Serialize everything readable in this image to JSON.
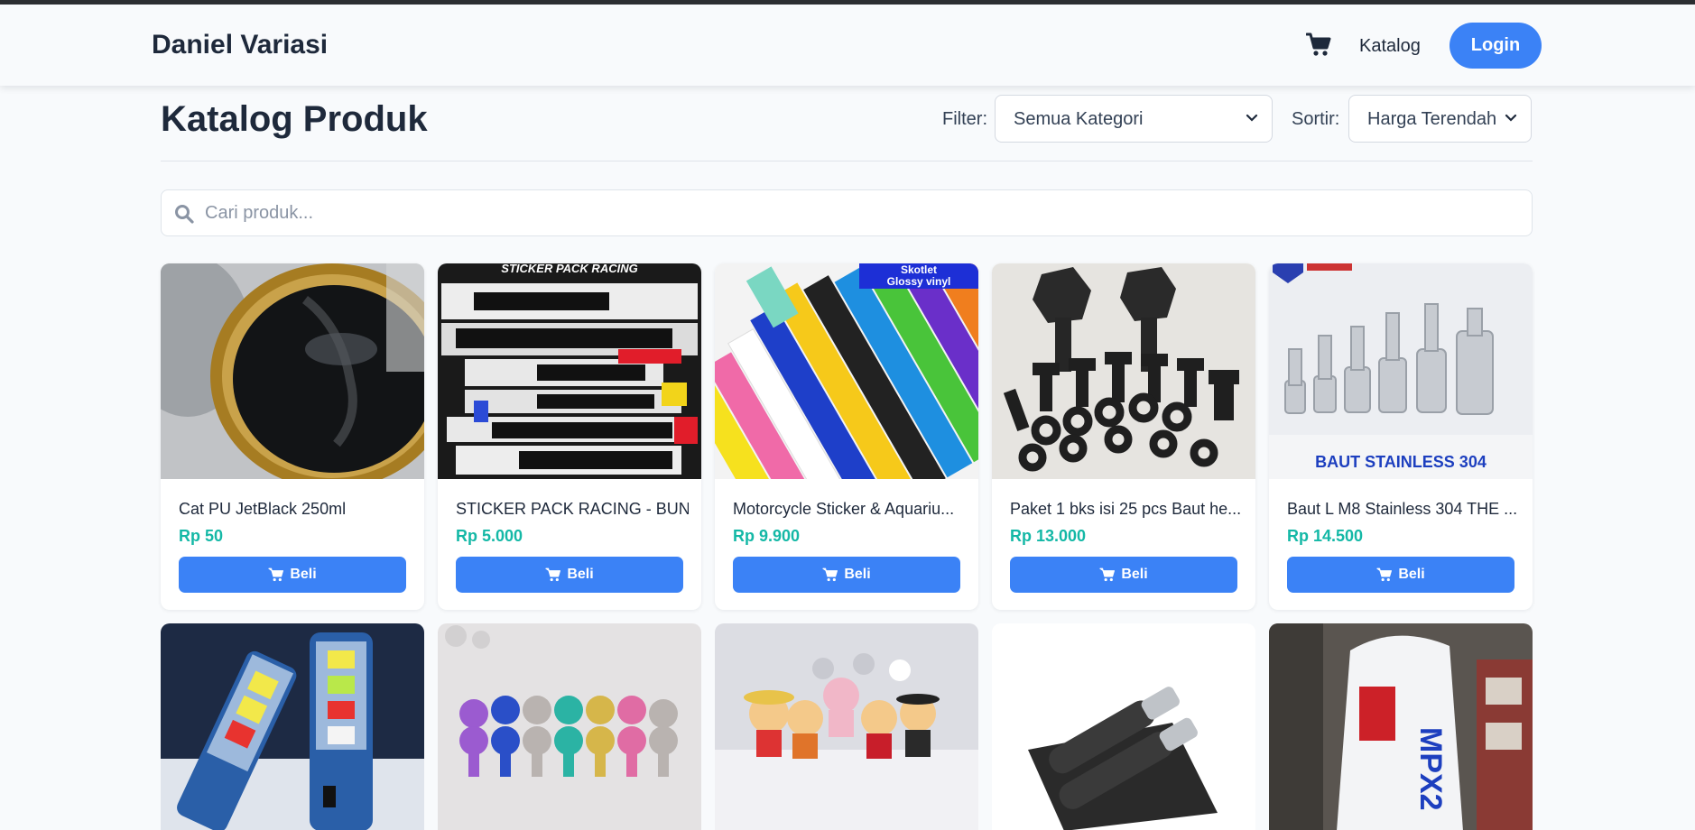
{
  "navbar": {
    "brand": "Daniel Variasi",
    "cart_icon": "shopping-cart-icon",
    "katalog_link": "Katalog",
    "login_label": "Login"
  },
  "page": {
    "title": "Katalog Produk",
    "filter_label": "Filter:",
    "filter_value": "Semua Kategori",
    "sort_label": "Sortir:",
    "sort_value": "Harga Terendah"
  },
  "search": {
    "placeholder": "Cari produk...",
    "icon": "search-icon"
  },
  "products": [
    {
      "name": "Cat PU JetBlack 250ml",
      "price": "Rp 50",
      "buy_label": "Beli"
    },
    {
      "name": "STICKER PACK RACING - BUN...",
      "price": "Rp 5.000",
      "buy_label": "Beli",
      "image_text": "STICKER PACK RACING"
    },
    {
      "name": "Motorcycle Sticker & Aquariu...",
      "price": "Rp 9.900",
      "buy_label": "Beli",
      "image_text": "Skotlet Glossy vinyl"
    },
    {
      "name": "Paket 1 bks isi 25 pcs Baut he...",
      "price": "Rp 13.000",
      "buy_label": "Beli"
    },
    {
      "name": "Baut L M8 Stainless 304 THE ...",
      "price": "Rp 14.500",
      "buy_label": "Beli",
      "image_text": "BAUT STAINLESS 304"
    }
  ],
  "products_row2": [
    {
      "image": "led-bulb-image"
    },
    {
      "image": "color-bolts-image"
    },
    {
      "image": "figure-keychains-image"
    },
    {
      "image": "handlebar-grips-image"
    },
    {
      "image": "oil-bottle-image",
      "image_text": "MPX2"
    }
  ],
  "colors": {
    "accent": "#3b82f6",
    "price": "#14b8a6",
    "text": "#1e293b",
    "background": "#f8fafc"
  }
}
